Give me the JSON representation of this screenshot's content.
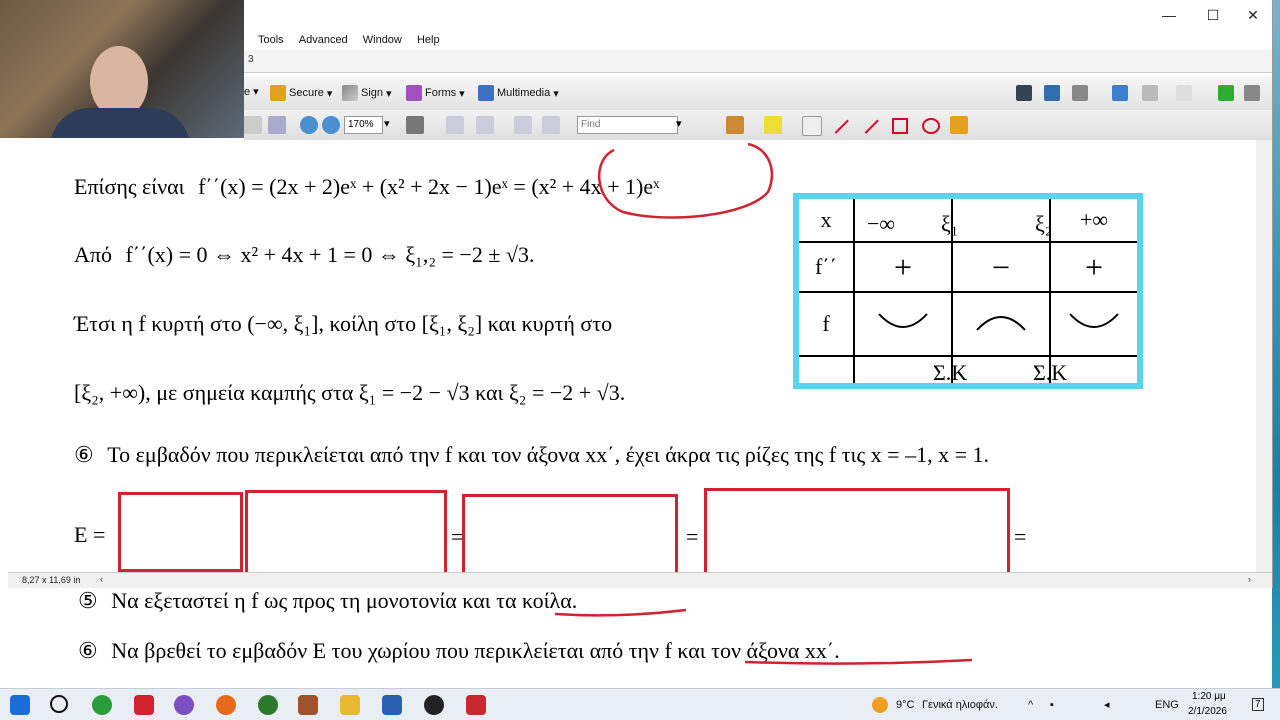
{
  "window": {
    "tab_text": "3",
    "minimize": "—",
    "maximize": "☐",
    "close": "✕"
  },
  "menu": [
    "Tools",
    "Advanced",
    "Window",
    "Help"
  ],
  "toolbar": {
    "create_label": "e",
    "secure_label": "Secure",
    "sign_label": "Sign",
    "forms_label": "Forms",
    "multimedia_label": "Multimedia"
  },
  "toolbar2": {
    "zoom": "170%",
    "find_placeholder": "Find"
  },
  "status": {
    "page_size": "8,27 x 11,69 in"
  },
  "doc": {
    "line1_prefix": "Επίσης είναι",
    "line1_formula": "f΄΄(x) = (2x + 2)eˣ + (x² + 2x − 1)eˣ = (x² + 4x + 1)eˣ",
    "line2_prefix": "Από",
    "line2_formula": "f΄΄(x) = 0 ⇔ x² + 4x + 1 = 0 ⇔ ξ₁,₂ = −2 ± √3.",
    "line3": "Έτσι η f κυρτή στο (−∞, ξ₁],  κοίλη στο [ξ₁, ξ₂] και κυρτή στο",
    "line4": "[ξ₂, +∞), με σημεία καμπής στα  ξ₁ = −2 − √3  και  ξ₂ = −2 + √3.",
    "item6_mark": "⑥",
    "item6_text": "Το εμβαδόν που περικλείεται από την f και τον άξονα xx΄, έχει άκρα τις ρίζες της f τις x = –1, x = 1.",
    "e_label": "E =",
    "eq": "="
  },
  "sign_table": {
    "row_x": [
      "x",
      "−∞",
      "ξ₁",
      "ξ₂",
      "+∞"
    ],
    "row_f2": [
      "f΄΄",
      "+",
      "−",
      "+"
    ],
    "row_f": [
      "f"
    ],
    "row_sk": [
      "Σ.Κ",
      "Σ.Κ"
    ]
  },
  "below": {
    "item5_mark": "⑤",
    "item5_text": "Να εξεταστεί η f ως προς τη μονοτονία και τα κοίλα.",
    "item6_mark": "⑥",
    "item6_text": "Να βρεθεί το εμβαδόν Ε του χωρίου που περικλείεται από την f και τον άξονα xx΄."
  },
  "taskbar": {
    "weather_temp": "9°C",
    "weather_text": "Γενικά ηλιοφάν.",
    "lang": "ENG",
    "time": "1:20 μμ",
    "date": "2/1/2026",
    "notif_count": "7"
  },
  "colors": {
    "accent_red": "#d0222f",
    "table_border": "#5bd3ef"
  }
}
